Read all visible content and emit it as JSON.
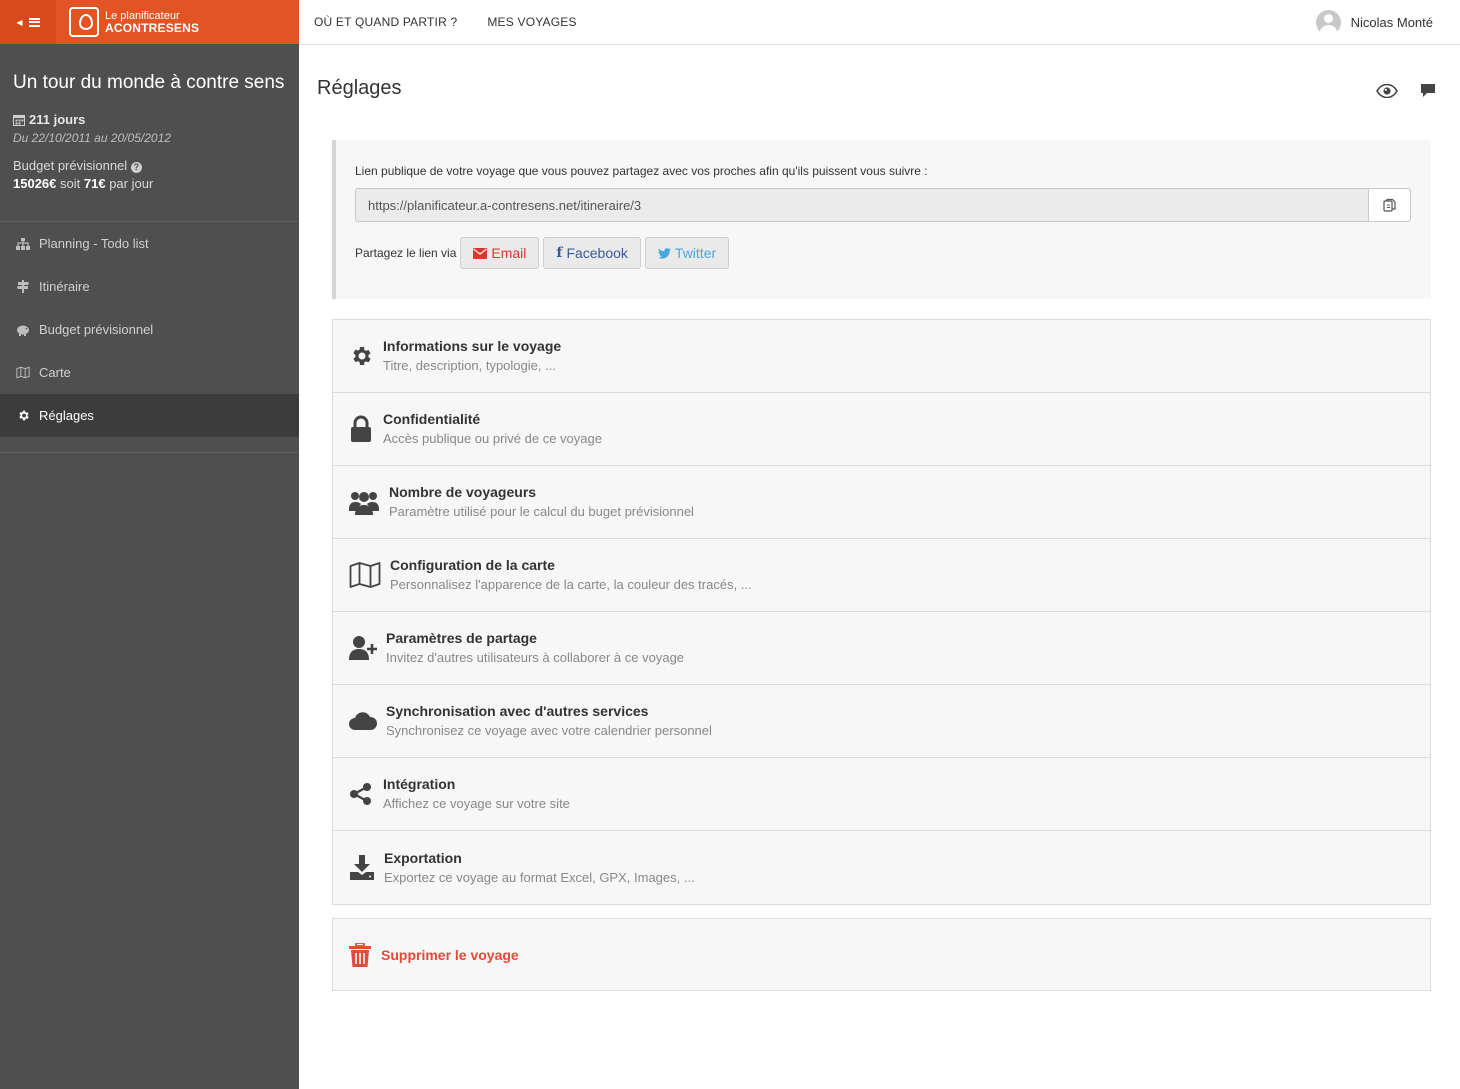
{
  "brand": {
    "line1": "Le planificateur",
    "line2": "ACONTRESENS"
  },
  "sidebar": {
    "trip_title": "Un tour du monde à contre sens",
    "duration": "211 jours",
    "dates": "Du 22/10/2011 au 20/05/2012",
    "budget_label": "Budget prévisionnel",
    "budget_total": "15026€",
    "budget_soit": "soit",
    "budget_per_day": "71€",
    "budget_per_day_suffix": "par jour",
    "items": [
      {
        "label": "Planning - Todo list",
        "icon": "sitemap-icon"
      },
      {
        "label": "Itinéraire",
        "icon": "signpost-icon"
      },
      {
        "label": "Budget prévisionnel",
        "icon": "piggy-bank-icon"
      },
      {
        "label": "Carte",
        "icon": "map-icon"
      },
      {
        "label": "Réglages",
        "icon": "gear-icon",
        "active": true
      }
    ]
  },
  "topnav": {
    "where_when": "OÙ ET QUAND PARTIR ?",
    "my_trips": "MES VOYAGES",
    "user_name": "Nicolas Monté"
  },
  "page": {
    "title": "Réglages"
  },
  "share": {
    "lead": "Lien publique de votre voyage que vous pouvez partagez avec vos proches afin qu'ils puissent vous suivre :",
    "url": "https://planificateur.a-contresens.net/itineraire/3",
    "via_label": "Partagez le lien via",
    "email": "Email",
    "facebook": "Facebook",
    "twitter": "Twitter"
  },
  "settings": [
    {
      "title": "Informations sur le voyage",
      "desc": "Titre, description, typologie, ...",
      "icon": "gear-icon"
    },
    {
      "title": "Confidentialité",
      "desc": "Accès publique ou privé de ce voyage",
      "icon": "lock-icon"
    },
    {
      "title": "Nombre de voyageurs",
      "desc": "Paramètre utilisé pour le calcul du buget prévisionnel",
      "icon": "users-icon"
    },
    {
      "title": "Configuration de la carte",
      "desc": "Personnalisez l'apparence de la carte, la couleur des tracés, ...",
      "icon": "map-icon"
    },
    {
      "title": "Paramètres de partage",
      "desc": "Invitez d'autres utilisateurs à collaborer à ce voyage",
      "icon": "user-plus-icon"
    },
    {
      "title": "Synchronisation avec d'autres services",
      "desc": "Synchronisez ce voyage avec votre calendrier personnel",
      "icon": "cloud-icon"
    },
    {
      "title": "Intégration",
      "desc": "Affichez ce voyage sur votre site",
      "icon": "share-icon"
    },
    {
      "title": "Exportation",
      "desc": "Exportez ce voyage au format Excel, GPX, Images, ...",
      "icon": "download-icon"
    }
  ],
  "delete": {
    "label": "Supprimer le voyage"
  },
  "colors": {
    "brand": "#e25424",
    "sidebar": "#4f4f4f",
    "danger": "#e04b3b"
  }
}
